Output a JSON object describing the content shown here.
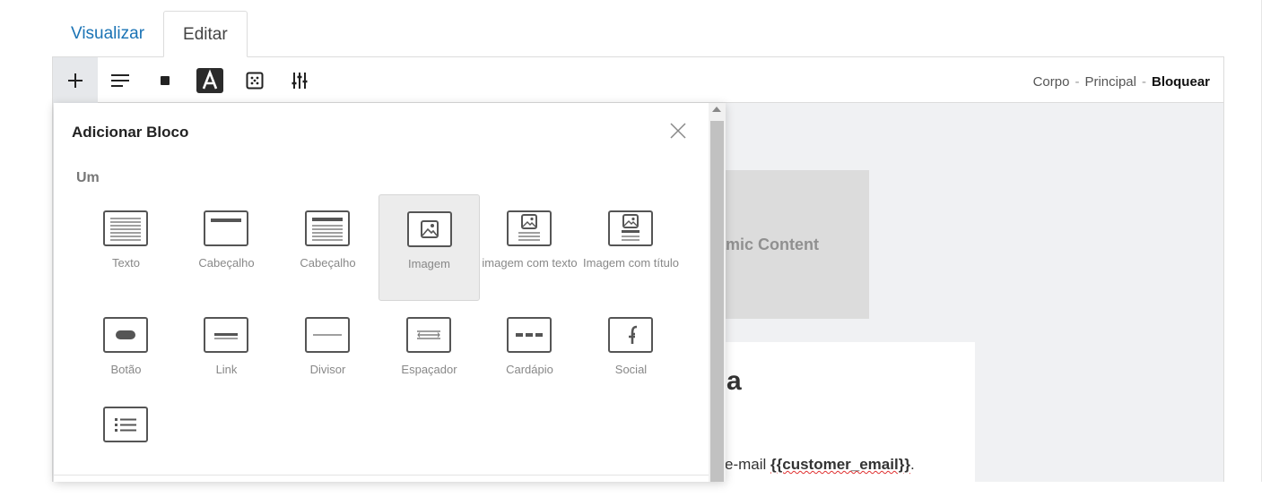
{
  "tabs": {
    "view_label": "Visualizar",
    "edit_label": "Editar"
  },
  "toolbar": {
    "buttons": [
      "add-block",
      "align",
      "block-style",
      "text-style",
      "layout-grid",
      "settings-sliders"
    ]
  },
  "breadcrumb": {
    "item1": "Corpo",
    "item2": "Principal",
    "item3": "Bloquear",
    "separator": "-"
  },
  "panel": {
    "title": "Adicionar Bloco",
    "section": "Um",
    "blocks": [
      {
        "label": "Texto",
        "icon": "text-block-icon"
      },
      {
        "label": "Cabeçalho",
        "icon": "header-block-icon"
      },
      {
        "label": "Cabeçalho",
        "icon": "header-text-block-icon"
      },
      {
        "label": "Imagem",
        "icon": "image-block-icon"
      },
      {
        "label": "imagem com texto",
        "icon": "image-text-block-icon"
      },
      {
        "label": "Imagem com título",
        "icon": "image-title-block-icon"
      },
      {
        "label": "Botão",
        "icon": "button-block-icon"
      },
      {
        "label": "Link",
        "icon": "link-block-icon"
      },
      {
        "label": "Divisor",
        "icon": "divider-block-icon"
      },
      {
        "label": "Espaçador",
        "icon": "spacer-block-icon"
      },
      {
        "label": "Cardápio",
        "icon": "menu-block-icon"
      },
      {
        "label": "Social",
        "icon": "social-block-icon"
      },
      {
        "label": "",
        "icon": "list-block-icon"
      }
    ]
  },
  "canvas": {
    "placeholder_text": "amic Content",
    "heading": "a",
    "line_prefix": "e-mail ",
    "merge_tag": "{{customer_email}}",
    "line_suffix": "."
  },
  "colors": {
    "accent": "#1a73b5",
    "selected_bg": "#ececec"
  }
}
